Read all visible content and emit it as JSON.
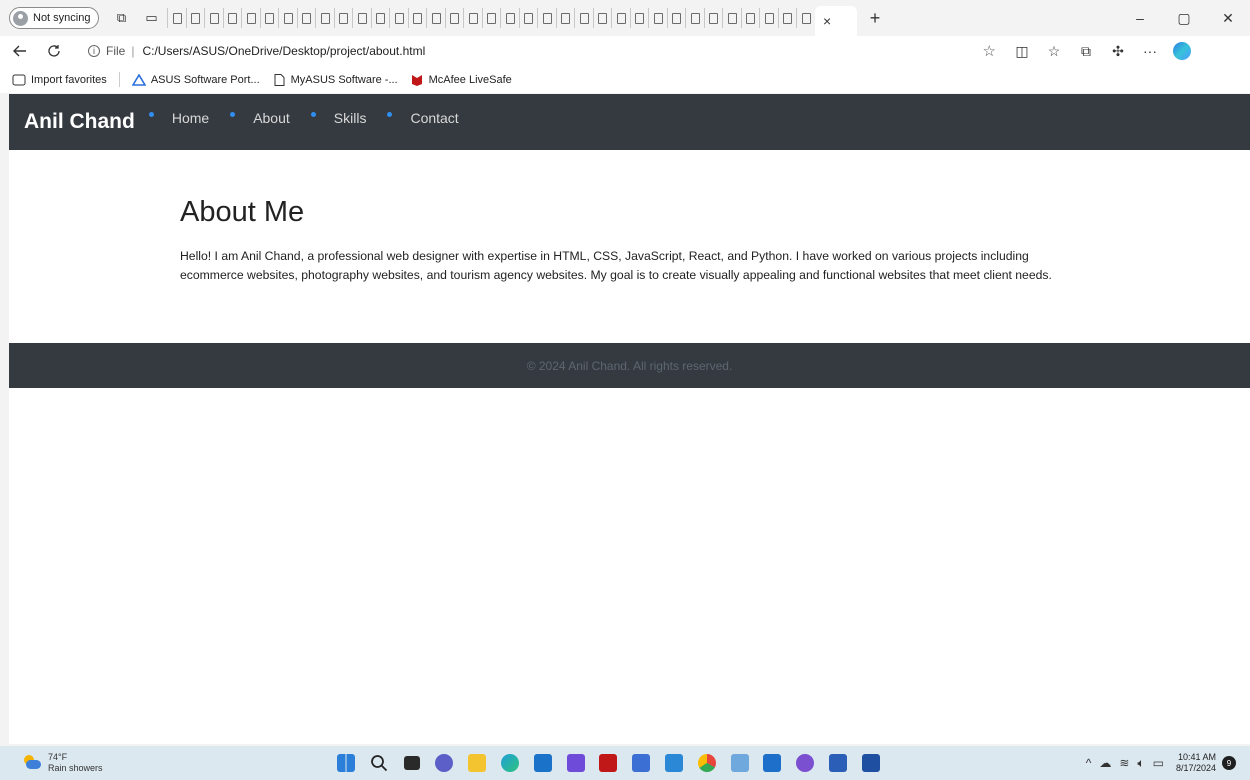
{
  "browser": {
    "profile_label": "Not syncing",
    "address": {
      "scheme_label": "File",
      "separator": "|",
      "url": "C:/Users/ASUS/OneDrive/Desktop/project/about.html",
      "info_icon": "i"
    },
    "favorites": [
      {
        "label": "Import favorites",
        "icon": "import-favorites-icon"
      },
      {
        "label": "ASUS Software Port...",
        "icon": "asus-icon"
      },
      {
        "label": "MyASUS Software -...",
        "icon": "page-icon"
      },
      {
        "label": "McAfee LiveSafe",
        "icon": "mcafee-icon"
      }
    ],
    "tab_close": "×",
    "new_tab": "+",
    "window_controls": {
      "minimize": "–",
      "maximize": "▢",
      "close": "✕"
    }
  },
  "site": {
    "brand": "Anil Chand",
    "nav": [
      "Home",
      "About",
      "Skills",
      "Contact"
    ],
    "about_title": "About Me",
    "about_text": "Hello! I am Anil Chand, a professional web designer with expertise in HTML, CSS, JavaScript, React, and Python. I have worked on various projects including ecommerce websites, photography websites, and tourism agency websites. My goal is to create visually appealing and functional websites that meet client needs.",
    "footer": "© 2024 Anil Chand. All rights reserved.",
    "colors": {
      "header_bg": "#343a40",
      "nav_dot": "#2f8ef0"
    }
  },
  "taskbar": {
    "weather_temp": "74°F",
    "weather_desc": "Rain showers",
    "time": "10:41 AM",
    "date": "8/17/2024",
    "notifications": "9"
  }
}
